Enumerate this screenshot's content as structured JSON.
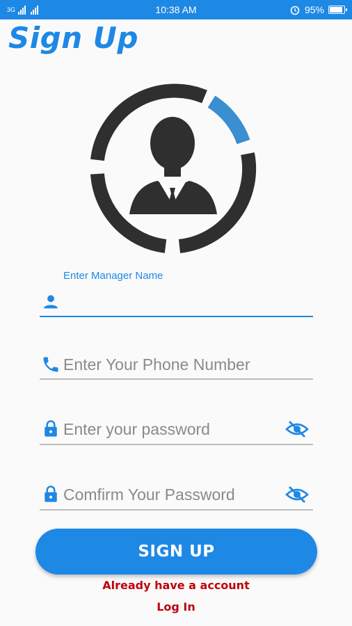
{
  "status_bar": {
    "signal_text": "3G",
    "time": "10:38 AM",
    "battery_percent": "95%",
    "battery_level": 0.95,
    "icons": [
      "signal-icon",
      "alarm-icon",
      "battery-icon"
    ]
  },
  "page": {
    "title": "Sign Up"
  },
  "avatar": {
    "icon": "person-icon"
  },
  "form": {
    "manager_name": {
      "label": "Enter Manager Name",
      "value": "",
      "icon": "person-icon"
    },
    "phone": {
      "placeholder": "Enter Your Phone Number",
      "value": "",
      "icon": "phone-icon"
    },
    "password": {
      "placeholder": "Enter your password",
      "value": "",
      "icon": "lock-icon",
      "toggle_icon": "eye-off-icon"
    },
    "confirm_password": {
      "placeholder": "Comfirm Your Password",
      "value": "",
      "icon": "lock-icon",
      "toggle_icon": "eye-off-icon"
    }
  },
  "actions": {
    "signup_label": "SIGN UP",
    "already_text": "Already have a account",
    "login_label": "Log In"
  },
  "colors": {
    "primary": "#1e88e5",
    "link": "#c0000c",
    "avatar_dark": "#2f2f2f",
    "avatar_accent": "#3a8fd0"
  }
}
